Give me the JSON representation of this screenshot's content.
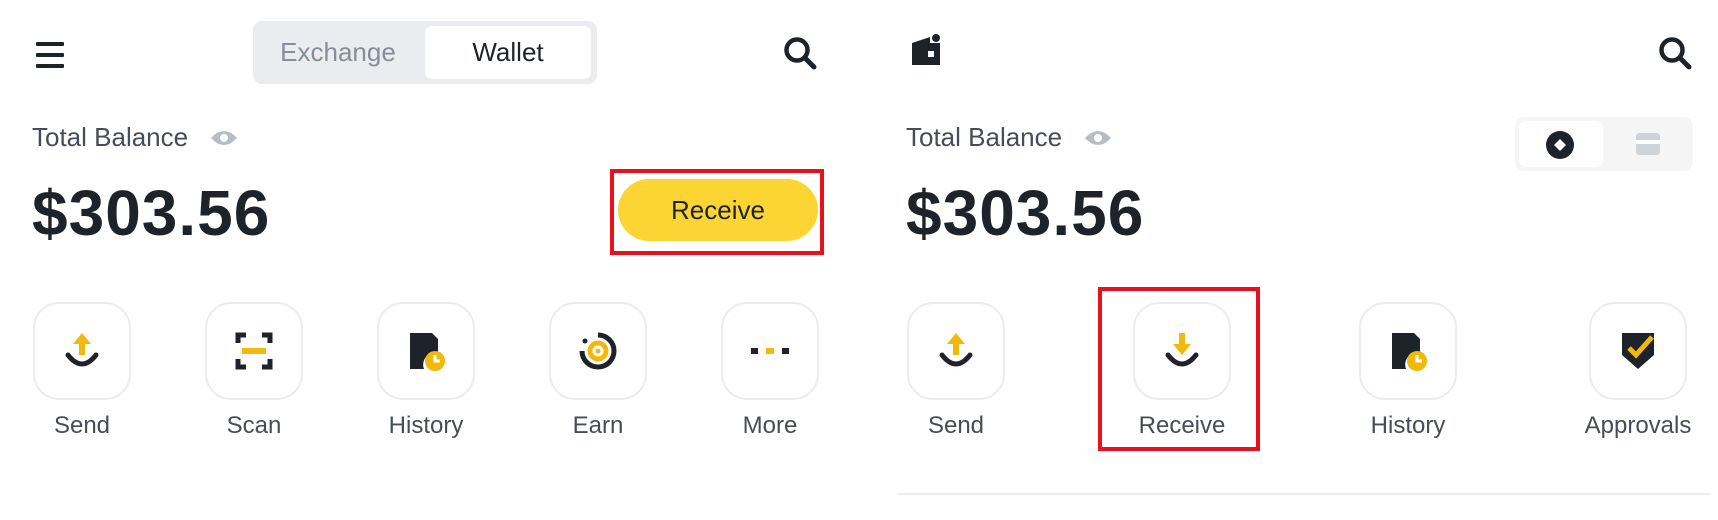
{
  "left_panel": {
    "tabs": {
      "exchange": "Exchange",
      "wallet": "Wallet",
      "active": "Wallet"
    },
    "balance_label": "Total Balance",
    "balance_value": "$303.56",
    "receive_button": "Receive",
    "actions": [
      {
        "label": "Send",
        "icon": "send-icon"
      },
      {
        "label": "Scan",
        "icon": "scan-icon"
      },
      {
        "label": "History",
        "icon": "history-icon"
      },
      {
        "label": "Earn",
        "icon": "earn-icon"
      },
      {
        "label": "More",
        "icon": "more-icon"
      }
    ]
  },
  "right_panel": {
    "balance_label": "Total Balance",
    "balance_value": "$303.56",
    "view_toggle": {
      "options": [
        "diamond-icon",
        "card-icon"
      ],
      "active": "diamond-icon"
    },
    "actions": [
      {
        "label": "Send",
        "icon": "send-icon"
      },
      {
        "label": "Receive",
        "icon": "receive-icon"
      },
      {
        "label": "History",
        "icon": "history-icon"
      },
      {
        "label": "Approvals",
        "icon": "approvals-icon"
      }
    ]
  },
  "colors": {
    "accent_yellow": "#fcd535",
    "text_primary": "#1e2329",
    "text_secondary": "#474d57",
    "muted": "#848e9c",
    "highlight_red": "#e8101b"
  }
}
